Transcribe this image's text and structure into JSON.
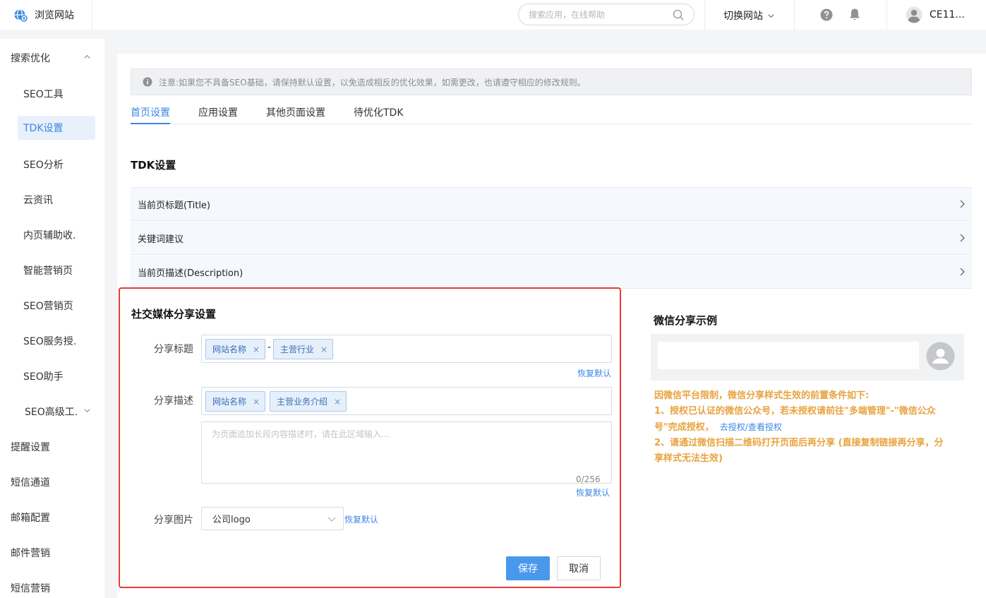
{
  "header": {
    "brand": "浏览网站",
    "search_placeholder": "搜索应用，在线帮助",
    "switch_site": "切换网站",
    "user_name": "CE11..."
  },
  "sidebar": {
    "group1": "搜索优化",
    "sub_items": [
      "SEO工具",
      "TDK设置",
      "SEO分析",
      "云资讯",
      "内页辅助收.",
      "智能营销页",
      "SEO营销页",
      "SEO服务授.",
      "SEO助手",
      "SEO高级工."
    ],
    "items": [
      "提醒设置",
      "短信通道",
      "邮箱配置",
      "邮件营销",
      "短信营销"
    ]
  },
  "main": {
    "notice": "注意:如果您不具备SEO基础，请保持默认设置，以免造成相反的优化效果，如需更改，也请遵守相应的修改规则。",
    "tabs": [
      "首页设置",
      "应用设置",
      "其他页面设置",
      "待优化TDK"
    ],
    "tdk_title": "TDK设置",
    "tdk_rows": [
      "当前页标题(Title)",
      "关键词建议",
      "当前页描述(Description)"
    ]
  },
  "share": {
    "title": "社交媒体分享设置",
    "title_label": "分享标题",
    "title_tags": [
      "网站名称",
      "主营行业"
    ],
    "separator": "-",
    "desc_label": "分享描述",
    "desc_tags": [
      "网站名称",
      "主营业务介绍"
    ],
    "desc_placeholder": "为页面追加长段内容描述时，请在此区域输入...",
    "desc_counter": "0/256",
    "image_label": "分享图片",
    "image_value": "公司logo",
    "restore": "恢复默认",
    "save": "保存",
    "cancel": "取消",
    "tag_remove": "×"
  },
  "wechat": {
    "title": "微信分享示例",
    "note_heading": "因微信平台限制，微信分享样式生效的前置条件如下:",
    "note_1a": "1、授权已认证的微信公众号，若未授权请前往\"多端管理\"-\"微信公众",
    "note_1b": "号\"完成授权，",
    "note_1_link": "去授权/查看授权",
    "note_2a": "2、请通过微信扫描二维码打开页面后再分享 (直接复制链接再分享，分",
    "note_2b": "享样式无法生效)"
  },
  "colors": {
    "accent": "#3b88e4",
    "highlight_border": "#e63b34",
    "warning_text": "#e8a33e"
  }
}
